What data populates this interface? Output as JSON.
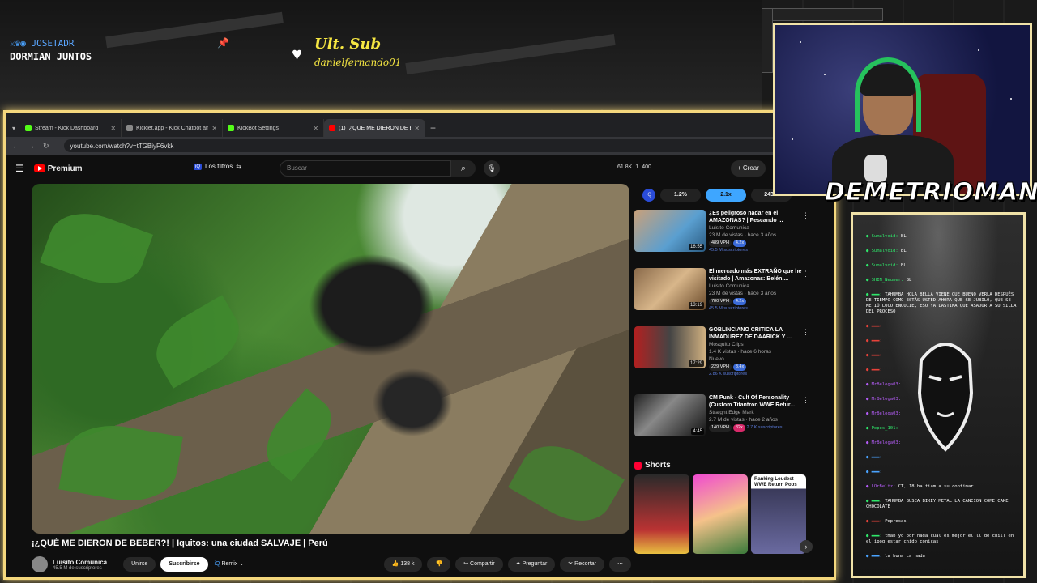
{
  "overlay": {
    "follower_name": "JOSETADR",
    "follower_status": "DORMIAN JUNTOS",
    "last_sub_title": "Ult. Sub",
    "last_sub_name": "danielfernando01",
    "streamer_name": "DEMETRIOMAN"
  },
  "browser": {
    "tabs": [
      {
        "label": "Stream - Kick Dashboard",
        "color": "#53fc18"
      },
      {
        "label": "Kicklet.app - Kick Chatbot and",
        "color": "#888888"
      },
      {
        "label": "KickBot Settings",
        "color": "#53fc18"
      },
      {
        "label": "(1) ¡¿QUÉ ME DIERON DE BEBE",
        "color": "#ff0000"
      }
    ],
    "url": "youtube.com/watch?v=tTGBiyF6vkk"
  },
  "youtube": {
    "brand": "Premium",
    "filters_badge": "iQ",
    "filters_label": "Los filtros",
    "search_placeholder": "Buscar",
    "stats": [
      "61.8K",
      "1",
      "400"
    ],
    "create_label": "Crear",
    "video_title": "¡¿QUÉ ME DIERON DE BEBER?! | Iquitos: una ciudad SALVAJE | Perú",
    "channel_name": "Luisito Comunica",
    "channel_subs": "45.5 M de suscriptores",
    "join_label": "Unirse",
    "subscribe_label": "Suscribirse",
    "remix_label": "Remix",
    "likes": "138 k",
    "share_label": "Compartir",
    "ask_label": "Preguntar",
    "clip_label": "Recortar",
    "speed_badge": "iQ",
    "speed_values": [
      "1.2%",
      "2.1x",
      "243.2"
    ],
    "recommendations": [
      {
        "title": "¿Es peligroso nadar en el AMAZONAS? | Pescando ...",
        "channel": "Luisito Comunica",
        "meta": "23 M de vistas · hace 3 años",
        "duration": "16:55",
        "vph": "489 VPH",
        "badge": "4.2x",
        "subs": "45.5 M suscriptores"
      },
      {
        "title": "El mercado más EXTRAÑO que he visitado | Amazonas: Belén,...",
        "channel": "Luisito Comunica",
        "meta": "23 M de vistas · hace 3 años",
        "duration": "13:19",
        "vph": "780 VPH",
        "badge": "4.2x",
        "subs": "45.5 M suscriptores"
      },
      {
        "title": "GOBLINCIANO CRITICA LA INMADUREZ DE DAARICK Y ...",
        "channel": "Mosquito Clips",
        "meta": "1.4 K vistas · hace 6 horas",
        "duration": "17:29",
        "vph": "229 VPH",
        "badge": "3.4x",
        "subs": "2.86 K suscriptores",
        "extra": "Nuevo"
      },
      {
        "title": "CM Punk - Cult Of Personality (Custom Titantron WWE Retur...",
        "channel": "Straight Edge Mark",
        "meta": "2.7 M de vistas · hace 2 años",
        "duration": "4:45",
        "vph": "140 VPH",
        "badge": "82x",
        "subs": "2.7 K suscriptores"
      }
    ],
    "shorts_label": "Shorts",
    "shorts_caption": "Ranking Loudest WWE Return Pops"
  },
  "chat": {
    "messages": [
      {
        "user": "Sumalvoid",
        "text": "BL",
        "color": "green"
      },
      {
        "user": "Sumalvoid",
        "text": "BL",
        "color": "green"
      },
      {
        "user": "Sumalvoid",
        "text": "BL",
        "color": "green"
      },
      {
        "user": "SHIN_Neuner",
        "text": "BL",
        "color": "green"
      },
      {
        "user": "",
        "text": "TAHUMBA HOLA BELLA VIENE QUE BUENO VERLA DESPUÉS DE TIEMPO COMO ESTÁS USTED AHORA QUE SE JUBILÓ, QUE SE METIÓ LOCO ENOOCIE, ESO YA LASTIMA QUE ASADOR A SU SILLA DEL PROCESO",
        "color": "green"
      },
      {
        "user": "",
        "text": "",
        "color": "red"
      },
      {
        "user": "",
        "text": "",
        "color": "red"
      },
      {
        "user": "",
        "text": "",
        "color": "red"
      },
      {
        "user": "",
        "text": "",
        "color": "red"
      },
      {
        "user": "MrBeloga03",
        "text": "",
        "color": "purple"
      },
      {
        "user": "MrBeloga03",
        "text": "",
        "color": "purple"
      },
      {
        "user": "MrBeloga03",
        "text": "",
        "color": "purple"
      },
      {
        "user": "Pepes_101",
        "text": "",
        "color": "green"
      },
      {
        "user": "MrBeloga03",
        "text": "",
        "color": "purple"
      },
      {
        "user": "",
        "text": "",
        "color": "blue"
      },
      {
        "user": "",
        "text": "",
        "color": "blue"
      },
      {
        "user": "LOrBeltz",
        "text": "CT, 18 ha tiam a su contimar",
        "color": "purple"
      },
      {
        "user": "",
        "text": "TAHUMBA BUSCA BIKEY METAL LA CANCION COME CAKE CHOCOLATE",
        "color": "green"
      },
      {
        "user": "",
        "text": "Pepresas",
        "color": "red"
      },
      {
        "user": "",
        "text": "tmab yo por nada cual es mejor el ll de chill en el ipog estar chido conicas",
        "color": "green"
      },
      {
        "user": "",
        "text": "la buna ca nada",
        "color": "blue"
      }
    ]
  }
}
